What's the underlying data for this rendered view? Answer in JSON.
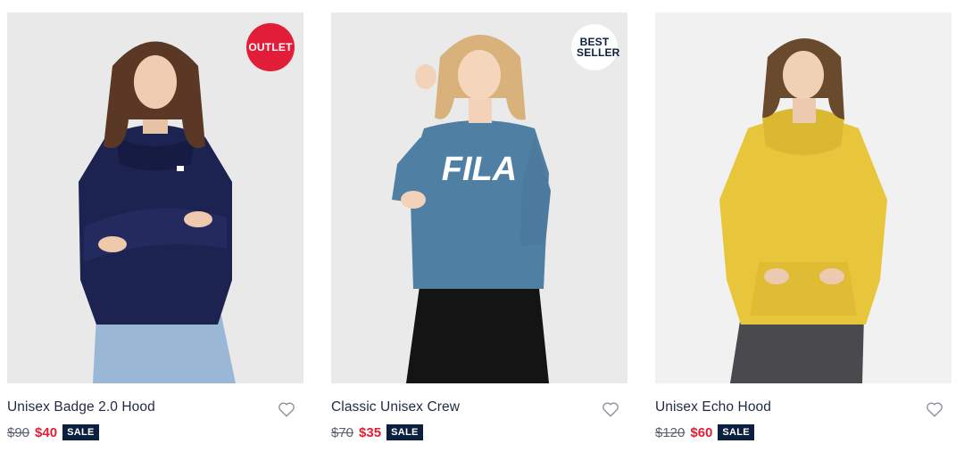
{
  "products": [
    {
      "name": "Unisex Badge 2.0 Hood",
      "old_price": "$90",
      "new_price": "$40",
      "sale_label": "SALE",
      "badge": "OUTLET",
      "badge_style": "outlet",
      "garment_color": "#1c2350",
      "pants_color": "#9ab7d6",
      "hair_color": "#5a3825",
      "image_bg": "#e9e9e9"
    },
    {
      "name": "Classic Unisex Crew",
      "old_price": "$70",
      "new_price": "$35",
      "sale_label": "SALE",
      "badge": "BEST SELLER",
      "badge_style": "best",
      "print_text": "FILA",
      "garment_color": "#4f7fa3",
      "pants_color": "#141414",
      "hair_color": "#d8b27a",
      "image_bg": "#eaeaea"
    },
    {
      "name": "Unisex Echo Hood",
      "old_price": "$120",
      "new_price": "$60",
      "sale_label": "SALE",
      "badge": "",
      "garment_color": "#e8c63b",
      "pants_color": "#4a4a4e",
      "hair_color": "#6a4a2c",
      "image_bg": "#f1f1f1"
    }
  ],
  "icons": {
    "wishlist": "heart-outline-icon"
  },
  "colors": {
    "accent_red": "#e11d37",
    "navy": "#0b1f3f",
    "text": "#1f2a44"
  }
}
